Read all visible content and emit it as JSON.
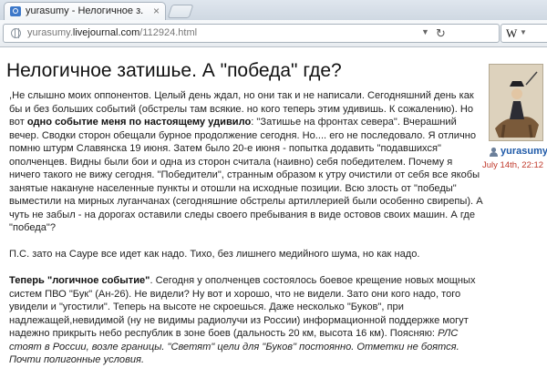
{
  "browser": {
    "tab_title": "yurasumy - Нелогичное з...",
    "tab_close": "×",
    "url_prefix": "yurasumy.",
    "url_domain": "livejournal.com",
    "url_path": "/112924.html",
    "search_engine": "W",
    "url_dropdown": "▼",
    "reload": "↻"
  },
  "post": {
    "title": "Нелогичное затишье. А \"победа\" где?",
    "p1_a": ",Не слышно моих оппонентов. Целый день ждал, но они так и не написали. Сегодняшний день как бы и без больших событий (обстрелы там всякие. но кого теперь этим удивишь. К сожалению). Но вот ",
    "p1_b": "одно событие меня по настоящему удивило",
    "p1_c": ": \"Затишье на фронтах севера\". Вчерашний вечер. Сводки сторон обещали бурное продолжение сегодня. Но.... его не последовало. Я отлично помню штурм Славянска 19 июня. Затем было 20-е июня - попытка додавить \"подавшихся\" ополченцев. Видны были бои и одна из сторон считала (наивно) себя победителем. Почему я ничего такого не вижу сегодня. \"Победители\", странным образом к утру очистили от себя все якобы занятые накануне населенные пункты и отошли на исходные позиции. Всю злость от \"победы\" выместили на мирных луганчанах (сегодняшние обстрелы артиллерией были особенно свирепы). А чуть не забыл - на дорогах оставили следы своего пребывания в виде остовов своих машин. А где \"победа\"?",
    "p2": "П.С. зато на Сауре все идет как надо. Тихо, без лишнего медийного шума, но как надо.",
    "p3_a": "Теперь \"логичное событие\"",
    "p3_b": ". Сегодня у ополченцев состоялось боевое крещение новых мощных систем ПВО \"Бук\" (Ан-26). Не видели? Ну вот и хорошо, что не видели. Зато они кого надо, того увидели и \"угостили\". Теперь на высоте не скроешься. Даже несколько \"Буков\", при надлежащей,невидимой (ну не видимы радиолучи из России) информационной поддержке могут надежно прикрыть небо республик в зоне боев (дальность 20 км, высота 16 км). Поясняю: ",
    "p3_c": "РЛС стоят в России, возле границы. \"Светят\" цели для \"Буков\" постоянно. Отметки не боятся. Почти полигонные условия."
  },
  "author": {
    "username": "yurasumy",
    "date": "July 14th, 22:12"
  },
  "colors": {
    "username": "#1f5aa8",
    "date": "#c0392b",
    "favicon": "#3d78c9"
  },
  "icons": [
    "livejournal-favicon",
    "globe-icon",
    "reload-icon",
    "wikipedia-search-icon",
    "user-icon"
  ]
}
